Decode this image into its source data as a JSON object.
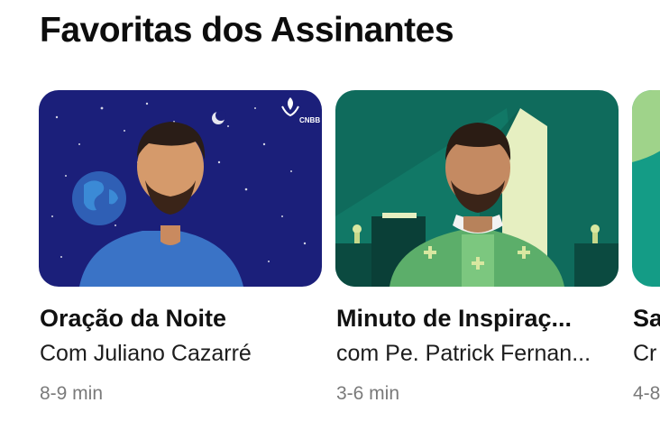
{
  "section": {
    "title": "Favoritas dos Assinantes"
  },
  "cards": [
    {
      "title": "Oração da Noite",
      "subtitle": "Com Juliano Cazarré",
      "duration": "8-9 min",
      "badge": "CNBB"
    },
    {
      "title": "Minuto de Inspiraç...",
      "subtitle": "com Pe. Patrick Fernan...",
      "duration": "3-6 min"
    },
    {
      "title": "Sa",
      "subtitle": "Cr",
      "duration": "4-8"
    }
  ],
  "colors": {
    "night": "#1b1f7a",
    "green": "#0f6b5c",
    "teal": "#149c86"
  }
}
